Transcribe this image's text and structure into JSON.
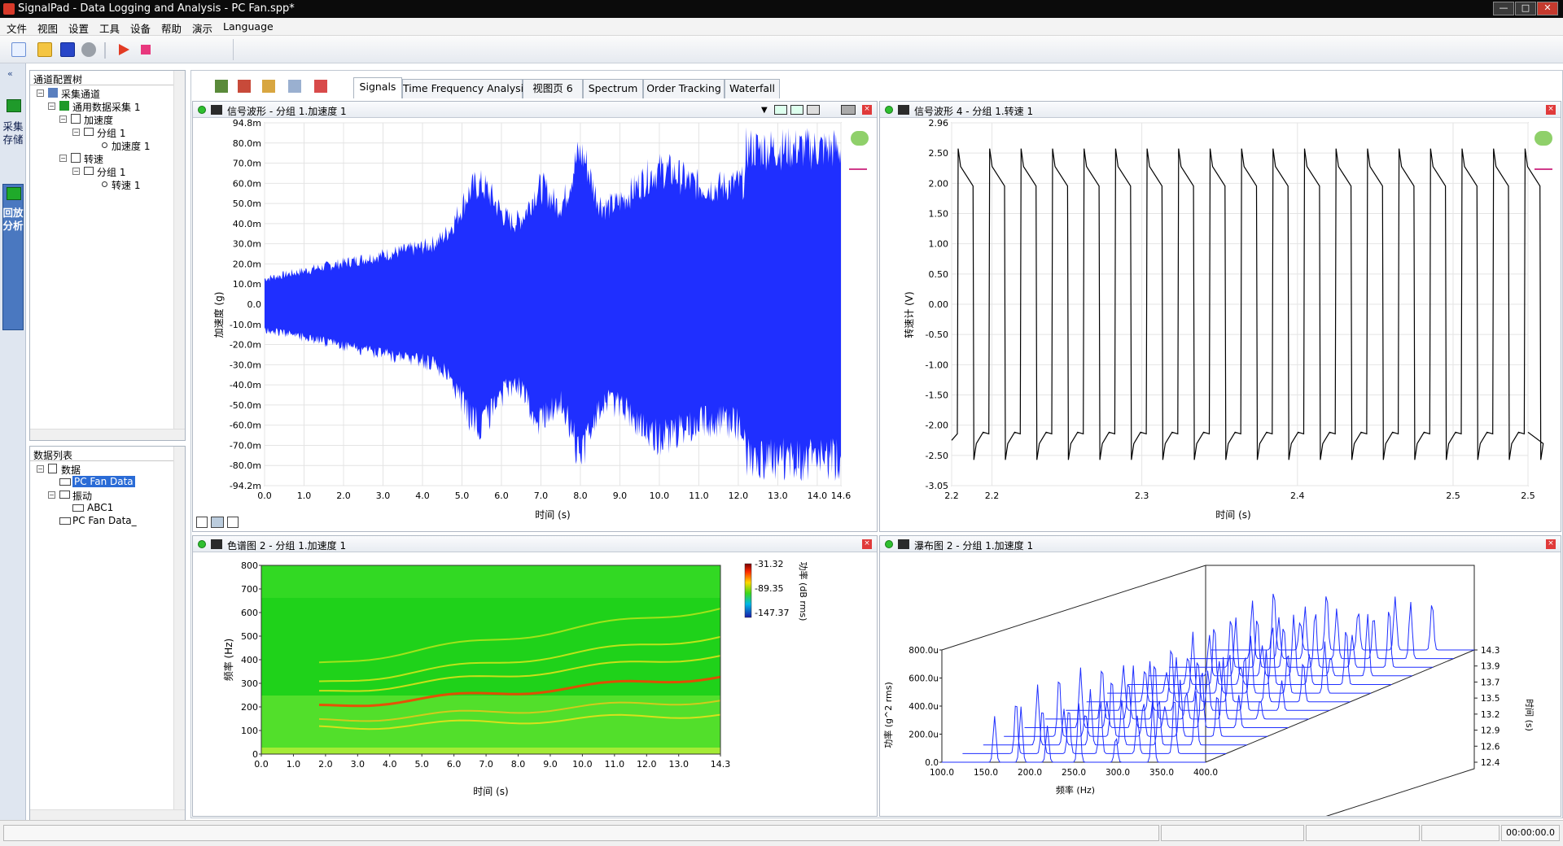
{
  "window": {
    "title": "SignalPad - Data Logging and Analysis - PC Fan.spp*",
    "controls": [
      "—",
      "□",
      "✕"
    ]
  },
  "menu": [
    "文件",
    "视图",
    "设置",
    "工具",
    "设备",
    "帮助",
    "演示",
    "Language"
  ],
  "toolbar": {
    "icons": [
      "new-icon",
      "open-icon",
      "save-icon",
      "settings-icon",
      "run-icon",
      "stop-icon"
    ]
  },
  "left_strip": {
    "tab1": "采集存储",
    "tab2": "回放分析"
  },
  "channel_tree": {
    "title": "通道配置树",
    "items": [
      {
        "label": "采集通道",
        "level": 0
      },
      {
        "label": "通用数据采集 1",
        "level": 1
      },
      {
        "label": "加速度",
        "level": 2
      },
      {
        "label": "分组 1",
        "level": 3
      },
      {
        "label": "加速度 1",
        "level": 4
      },
      {
        "label": "转速",
        "level": 2
      },
      {
        "label": "分组 1",
        "level": 3
      },
      {
        "label": "转速 1",
        "level": 4
      }
    ]
  },
  "data_list": {
    "title": "数据列表",
    "items": [
      {
        "label": "数据",
        "level": 0
      },
      {
        "label": "PC Fan Data",
        "level": 1,
        "selected": true
      },
      {
        "label": "振动",
        "level": 1
      },
      {
        "label": "ABC1",
        "level": 2
      },
      {
        "label": "PC Fan Data_",
        "level": 1
      }
    ]
  },
  "view_tabs": [
    "Signals",
    "Time Frequency Analysis",
    "视图页 6",
    "Spectrum",
    "Order Tracking",
    "Waterfall"
  ],
  "active_tab": "Signals",
  "charts": {
    "wave1": {
      "title": "信号波形 - 分组 1.加速度 1",
      "ylabel": "加速度 (g)",
      "xlabel": "时间 (s)",
      "yticks": [
        "94.8m",
        "80.0m",
        "70.0m",
        "60.0m",
        "50.0m",
        "40.0m",
        "30.0m",
        "20.0m",
        "10.0m",
        "0.0",
        "-10.0m",
        "-20.0m",
        "-30.0m",
        "-40.0m",
        "-50.0m",
        "-60.0m",
        "-70.0m",
        "-80.0m",
        "-94.2m"
      ],
      "xticks": [
        "0.0",
        "1.0",
        "2.0",
        "3.0",
        "4.0",
        "5.0",
        "6.0",
        "7.0",
        "8.0",
        "9.0",
        "10.0",
        "11.0",
        "12.0",
        "13.0",
        "14.0",
        "14.6"
      ],
      "color": "#1f2fff"
    },
    "wave4": {
      "title": "信号波形 4 - 分组 1.转速 1",
      "ylabel": "转速计 (V)",
      "xlabel": "时间 (s)",
      "yticks": [
        "2.96",
        "2.50",
        "2.00",
        "1.50",
        "1.00",
        "0.50",
        "0.00",
        "-0.50",
        "-1.00",
        "-1.50",
        "-2.00",
        "-2.50",
        "-3.05"
      ],
      "xticks": [
        "2.2",
        "2.2",
        "2.3",
        "2.4",
        "2.5",
        "2.5"
      ]
    },
    "spectrogram": {
      "title": "色谱图 2 - 分组 1.加速度 1",
      "ylabel": "频率 (Hz)",
      "xlabel": "时间 (s)",
      "yticks": [
        "800",
        "700",
        "600",
        "500",
        "400",
        "300",
        "200",
        "100",
        "0"
      ],
      "xticks": [
        "0.0",
        "1.0",
        "2.0",
        "3.0",
        "4.0",
        "5.0",
        "6.0",
        "7.0",
        "8.0",
        "9.0",
        "10.0",
        "11.0",
        "12.0",
        "13.0",
        "14.3"
      ],
      "colorbar": [
        "-31.32",
        "-89.35",
        "-147.37"
      ],
      "colorbar_label": "功率 (dB rms)"
    },
    "waterfall": {
      "title": "瀑布图 2 - 分组 1.加速度 1",
      "ylabel": "功率 (g^2 rms)",
      "xlabel": "频率 (Hz)",
      "zlabel": "时间 (s)",
      "yticks": [
        "800.0u",
        "600.0u",
        "400.0u",
        "200.0u",
        "0.0"
      ],
      "xticks": [
        "100.0",
        "150.0",
        "200.0",
        "250.0",
        "300.0",
        "350.0",
        "400.0"
      ],
      "zticks": [
        "14.3",
        "13.9",
        "13.7",
        "13.5",
        "13.2",
        "12.9",
        "12.6",
        "12.4"
      ],
      "color": "#1f2fff"
    }
  },
  "status": {
    "time": "00:00:00.0"
  }
}
